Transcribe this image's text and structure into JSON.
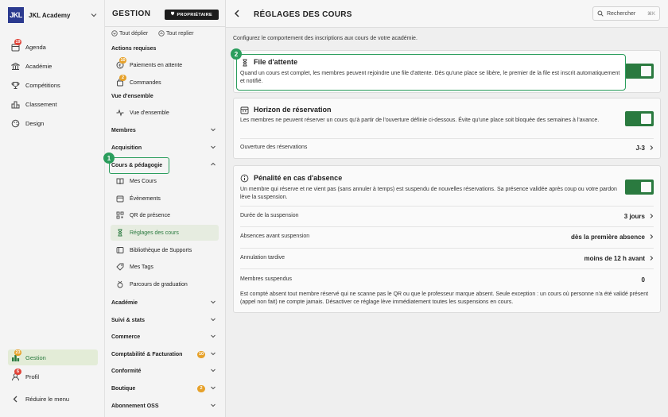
{
  "brand": {
    "name": "JKL Academy",
    "logo_text": "JKL"
  },
  "leftnav": {
    "items": [
      {
        "label": "Agenda",
        "badge": "19",
        "icon": "calendar-icon"
      },
      {
        "label": "Académie",
        "icon": "academy-icon"
      },
      {
        "label": "Compétitions",
        "icon": "trophy-icon"
      },
      {
        "label": "Classement",
        "icon": "ranking-icon"
      },
      {
        "label": "Design",
        "icon": "palette-icon"
      }
    ],
    "bottom": {
      "gestion": {
        "label": "Gestion",
        "badge": "23"
      },
      "profil": {
        "label": "Profil",
        "badge": "6"
      },
      "collapse": {
        "label": "Réduire le menu"
      }
    }
  },
  "mid": {
    "title": "GESTION",
    "owner_badge": "PROPRIÉTAIRE",
    "expand_all": "Tout déplier",
    "collapse_all": "Tout replier",
    "actions_title": "Actions requises",
    "actions": [
      {
        "label": "Paiements en attente",
        "badge": "10"
      },
      {
        "label": "Commandes",
        "badge": "2"
      }
    ],
    "overview_title": "Vue d'ensemble",
    "overview_item": "Vue d'ensemble",
    "sections": {
      "membres": "Membres",
      "acquisition": "Acquisition",
      "cours": "Cours & pédagogie",
      "academie": "Académie",
      "suivi": "Suivi & stats",
      "commerce": "Commerce",
      "compta": "Comptabilité & Facturation",
      "conformite": "Conformité",
      "boutique": "Boutique",
      "abonnement": "Abonnement OSS"
    },
    "compta_badge": "10",
    "boutique_badge": "2",
    "cours_items": [
      {
        "label": "Mes Cours"
      },
      {
        "label": "Évènements"
      },
      {
        "label": "QR de présence"
      },
      {
        "label": "Réglages des cours"
      },
      {
        "label": "Bibliothèque de Supports"
      },
      {
        "label": "Mes Tags"
      },
      {
        "label": "Parcours de graduation"
      }
    ]
  },
  "steps": {
    "one": "1",
    "two": "2"
  },
  "main": {
    "title": "RÉGLAGES DES COURS",
    "search_label": "Rechercher",
    "search_kbd": "⌘K",
    "intro": "Configurez le comportement des inscriptions aux cours de votre académie.",
    "waitlist": {
      "title": "File d'attente",
      "desc": "Quand un cours est complet, les membres peuvent rejoindre une file d'attente. Dès qu'une place se libère, le premier de la file est inscrit automatiquement et notifié.",
      "enabled": true
    },
    "horizon": {
      "title": "Horizon de réservation",
      "desc": "Les membres ne peuvent réserver un cours qu'à partir de l'ouverture définie ci-dessous. Évite qu'une place soit bloquée des semaines à l'avance.",
      "enabled": true,
      "row_label": "Ouverture des réservations",
      "row_value": "J-3"
    },
    "penalty": {
      "title": "Pénalité en cas d'absence",
      "desc": "Un membre qui réserve et ne vient pas (sans annuler à temps) est suspendu de nouvelles réservations. Sa présence validée après coup ou votre pardon lève la suspension.",
      "enabled": true,
      "rows": [
        {
          "label": "Durée de la suspension",
          "value": "3 jours"
        },
        {
          "label": "Absences avant suspension",
          "value": "dès la première absence"
        },
        {
          "label": "Annulation tardive",
          "value": "moins de 12 h avant"
        },
        {
          "label": "Membres suspendus",
          "value": "0"
        }
      ],
      "footnote": "Est compté absent tout membre réservé qui ne scanne pas le QR ou que le professeur marque absent. Seule exception : un cours où personne n'a été validé présent (appel non fait) ne compte jamais. Désactiver ce réglage lève immédiatement toutes les suspensions en cours."
    }
  },
  "colors": {
    "accent": "#2a7a3f",
    "callout": "#2a9d5c",
    "badge_red": "#e0453a",
    "badge_orange": "#e6a12a"
  }
}
